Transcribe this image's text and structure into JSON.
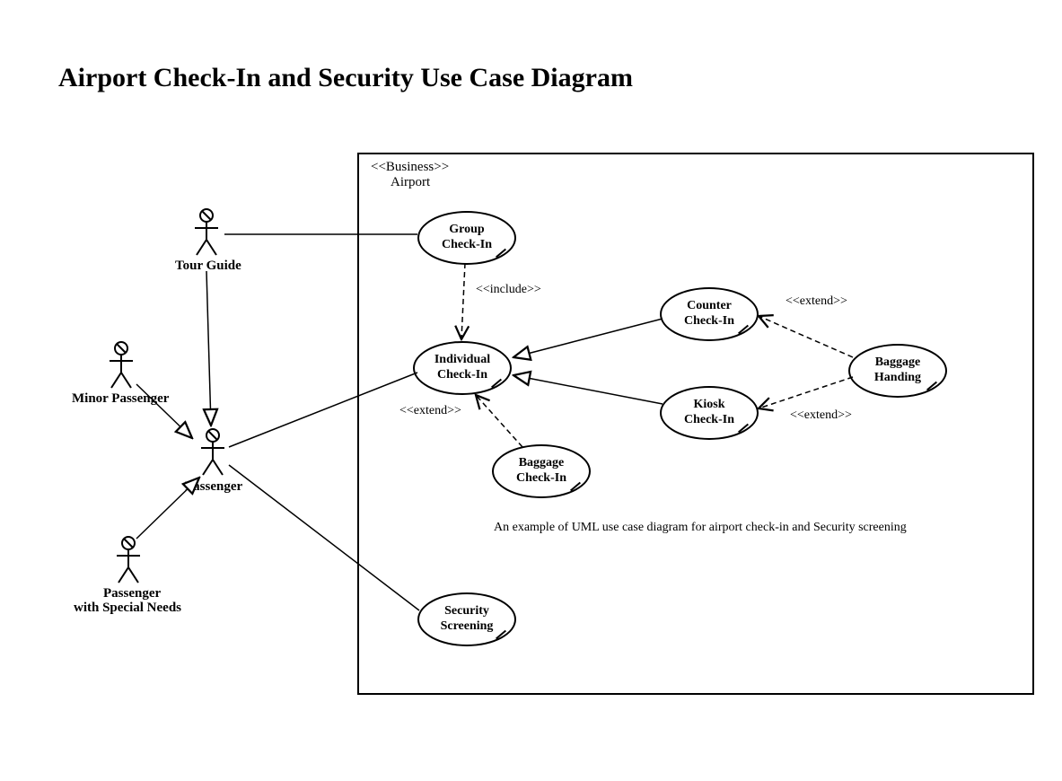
{
  "title": "Airport Check-In and Security Use Case Diagram",
  "system": {
    "stereotype": "<<Business>>",
    "name": "Airport"
  },
  "actors": {
    "tour_guide": "Tour Guide",
    "minor_passenger": "Minor Passenger",
    "passenger": "Passenger",
    "passenger_special": "Passenger\nwith Special Needs"
  },
  "usecases": {
    "group_checkin": "Group Check-In",
    "individual_checkin": "Individual Check-In",
    "counter_checkin": "Counter Check-In",
    "kiosk_checkin": "Kiosk Check-In",
    "baggage_handing": "Baggage Handing",
    "baggage_checkin": "Baggage Check-In",
    "security_screening": "Security Screening"
  },
  "relationships": {
    "include": "<<include>>",
    "extend1": "<<extend>>",
    "extend2": "<<extend>>",
    "extend3": "<<extend>>"
  },
  "note": "An example of UML use case diagram for airport check-in and Security screening"
}
